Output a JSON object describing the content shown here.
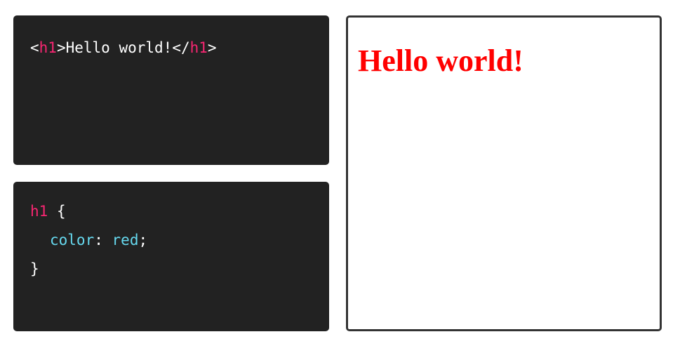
{
  "html_editor": {
    "open_bracket": "<",
    "tag_name": "h1",
    "close_bracket": ">",
    "content": "Hello world!",
    "end_open": "</",
    "end_tag_name": "h1",
    "end_close": ">"
  },
  "css_editor": {
    "selector": "h1",
    "open_brace": "{",
    "property": "color",
    "colon": ":",
    "value": "red",
    "semicolon": ";",
    "close_brace": "}"
  },
  "preview": {
    "heading_text": "Hello world!",
    "heading_color": "#ff0000"
  },
  "colors": {
    "editor_background": "#222222",
    "tag_color": "#f92672",
    "property_color": "#66d9ef",
    "preview_border": "#333333"
  }
}
